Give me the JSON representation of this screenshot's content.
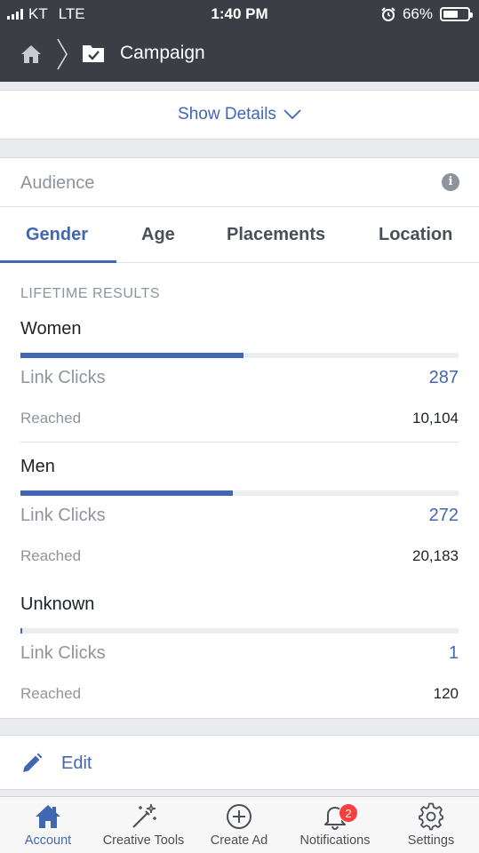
{
  "status_bar": {
    "carrier": "KT",
    "network": "LTE",
    "time": "1:40 PM",
    "battery": "66%",
    "battery_level": 0.66
  },
  "header": {
    "title": "Campaign"
  },
  "details": {
    "label": "Show Details"
  },
  "audience": {
    "title": "Audience",
    "tabs": [
      {
        "label": "Gender",
        "active": true
      },
      {
        "label": "Age",
        "active": false
      },
      {
        "label": "Placements",
        "active": false
      },
      {
        "label": "Location",
        "active": false
      }
    ],
    "section_label": "LIFETIME RESULTS",
    "groups": [
      {
        "name": "Women",
        "clicks_label": "Link Clicks",
        "clicks": "287",
        "reached_label": "Reached",
        "reached": "10,104",
        "share": 0.51
      },
      {
        "name": "Men",
        "clicks_label": "Link Clicks",
        "clicks": "272",
        "reached_label": "Reached",
        "reached": "20,183",
        "share": 0.485
      },
      {
        "name": "Unknown",
        "clicks_label": "Link Clicks",
        "clicks": "1",
        "reached_label": "Reached",
        "reached": "120",
        "share": 0.004
      }
    ]
  },
  "edit": {
    "label": "Edit"
  },
  "tabbar": [
    {
      "label": "Account",
      "icon": "home-icon",
      "active": true
    },
    {
      "label": "Creative Tools",
      "icon": "magic-wand-icon",
      "active": false
    },
    {
      "label": "Create Ad",
      "icon": "plus-circle-icon",
      "active": false
    },
    {
      "label": "Notifications",
      "icon": "bell-icon",
      "active": false,
      "badge": "2"
    },
    {
      "label": "Settings",
      "icon": "gear-icon",
      "active": false
    }
  ],
  "colors": {
    "accent": "#4267b2",
    "header": "#3b3f45",
    "badge": "#fa3e3e"
  }
}
